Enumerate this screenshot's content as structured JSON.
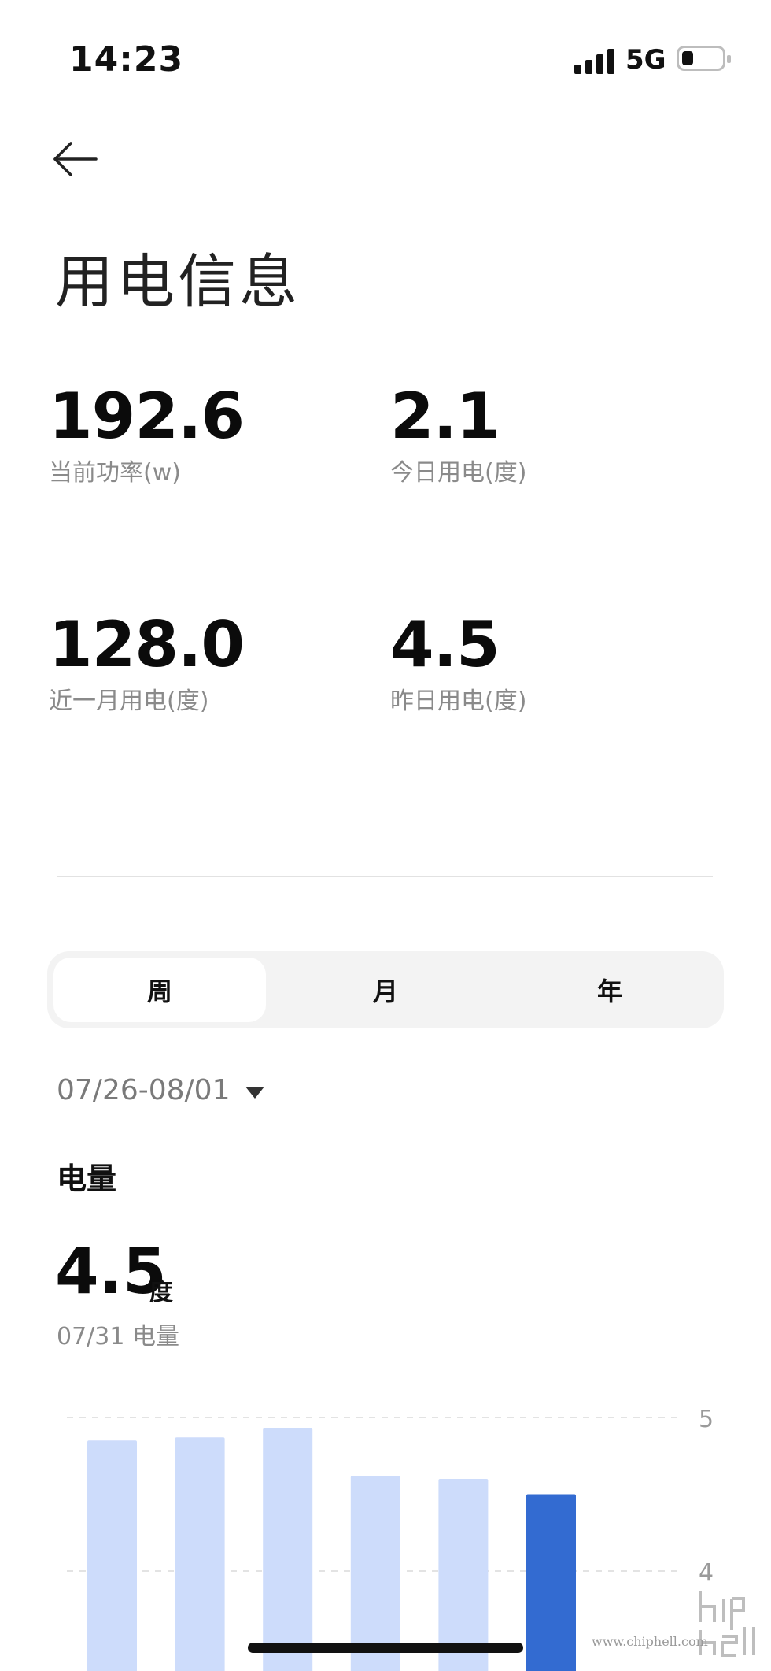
{
  "status_bar": {
    "time": "14:23",
    "network": "5G"
  },
  "header": {
    "title": "用电信息"
  },
  "stats": [
    {
      "value": "192.6",
      "label": "当前功率(w)"
    },
    {
      "value": "2.1",
      "label": "今日用电(度)"
    },
    {
      "value": "128.0",
      "label": "近一月用电(度)"
    },
    {
      "value": "4.5",
      "label": "昨日用电(度)"
    }
  ],
  "period_tabs": {
    "items": [
      "周",
      "月",
      "年"
    ],
    "selected": "周"
  },
  "date_range": "07/26-08/01",
  "metric": {
    "name": "电量",
    "value": "4.5",
    "unit": "度",
    "subtitle": "07/31 电量"
  },
  "chart_data": {
    "type": "bar",
    "y_ticks": [
      "5",
      "4"
    ],
    "ylim_visible": [
      3.0,
      5.0
    ],
    "values": [
      4.85,
      4.87,
      4.93,
      4.62,
      4.6,
      4.5
    ],
    "highlighted_index": 5,
    "colors": {
      "bar": "#cddcfb",
      "highlight": "#336bd1",
      "grid": "#e3e3e3"
    }
  },
  "watermark": {
    "url": "www.chiphell.com",
    "logo": "chip hell"
  }
}
